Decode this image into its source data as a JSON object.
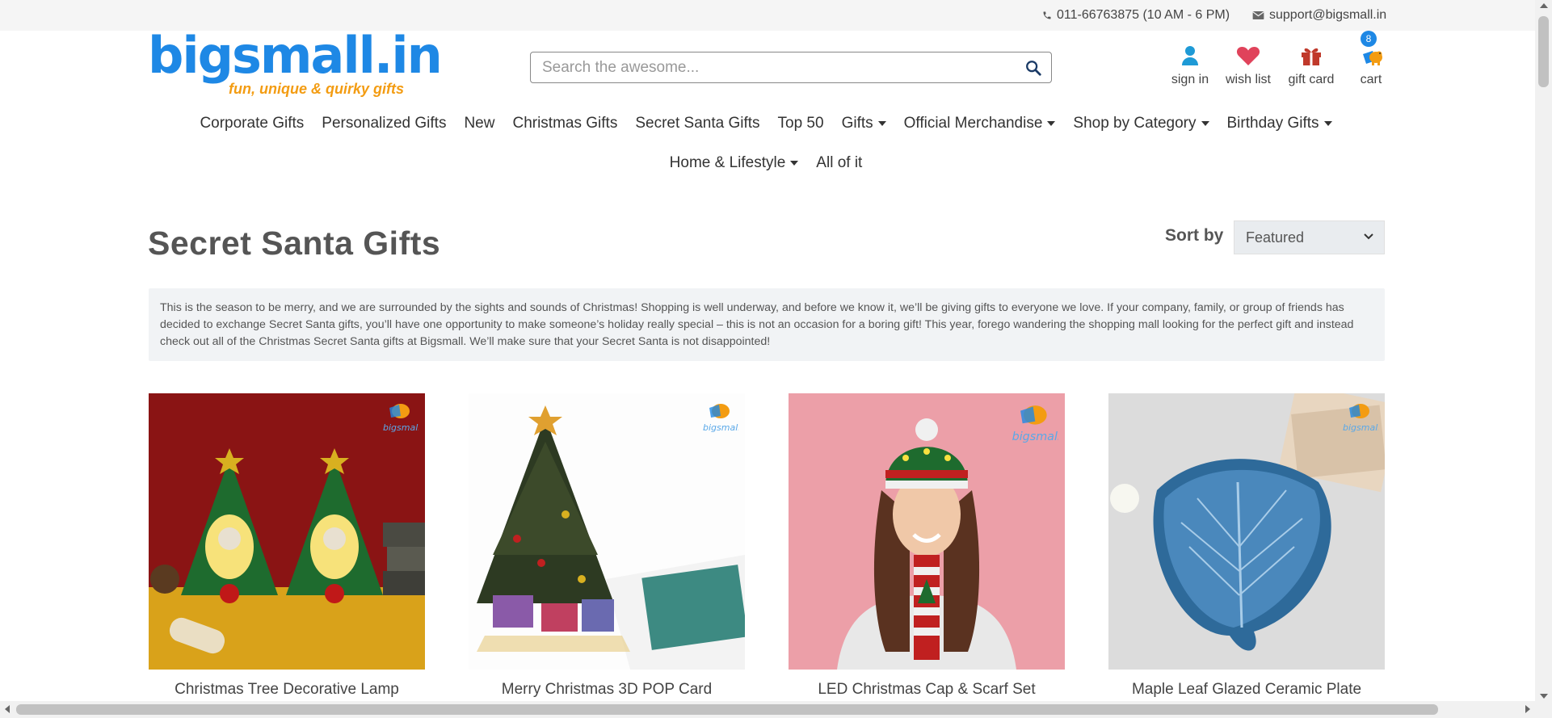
{
  "topbar": {
    "phone": "011-66763875 (10 AM - 6 PM)",
    "email": "support@bigsmall.in"
  },
  "logo": {
    "text": "bigsmall.in",
    "tagline": "fun, unique & quirky gifts"
  },
  "search": {
    "placeholder": "Search the awesome..."
  },
  "account": {
    "signin": "sign in",
    "wishlist": "wish list",
    "giftcard": "gift card",
    "cart": "cart",
    "cart_count": "8"
  },
  "nav": {
    "row1": [
      {
        "label": "Corporate Gifts",
        "dropdown": false
      },
      {
        "label": "Personalized Gifts",
        "dropdown": false
      },
      {
        "label": "New",
        "dropdown": false
      },
      {
        "label": "Christmas Gifts",
        "dropdown": false
      },
      {
        "label": "Secret Santa Gifts",
        "dropdown": false
      },
      {
        "label": "Top 50",
        "dropdown": false
      },
      {
        "label": "Gifts",
        "dropdown": true
      },
      {
        "label": "Official Merchandise",
        "dropdown": true
      },
      {
        "label": "Shop by Category",
        "dropdown": true
      },
      {
        "label": "Birthday Gifts",
        "dropdown": true
      }
    ],
    "row2": [
      {
        "label": "Home & Lifestyle",
        "dropdown": true
      },
      {
        "label": "All of it",
        "dropdown": false
      }
    ]
  },
  "page": {
    "title": "Secret Santa Gifts",
    "sort_label": "Sort by",
    "sort_value": "Featured",
    "description": "This is the season to be merry, and we are surrounded by the sights and sounds of Christmas! Shopping is well underway, and before we know it, we’ll be giving gifts to everyone we love. If your company, family, or group of friends has decided to exchange Secret Santa gifts, you’ll have one opportunity to make someone’s holiday really special – this is not an occasion for a boring gift! This year, forego wandering the shopping mall looking for the perfect gift and instead check out all of the Christmas Secret Santa gifts at Bigsmall. We’ll make sure that your Secret Santa is not disappointed!"
  },
  "products": [
    {
      "name": "Christmas Tree Decorative Lamp",
      "image": "christmas-tree-lamps"
    },
    {
      "name": "Merry Christmas 3D POP Card",
      "image": "christmas-pop-card"
    },
    {
      "name": "LED Christmas Cap & Scarf Set",
      "image": "cap-scarf-model"
    },
    {
      "name": "Maple Leaf Glazed Ceramic Plate",
      "image": "leaf-plate"
    }
  ],
  "colors": {
    "brand_blue": "#1e88e5",
    "brand_orange": "#f39c12",
    "heart_red": "#e0435b",
    "gift_red": "#c0392b"
  }
}
